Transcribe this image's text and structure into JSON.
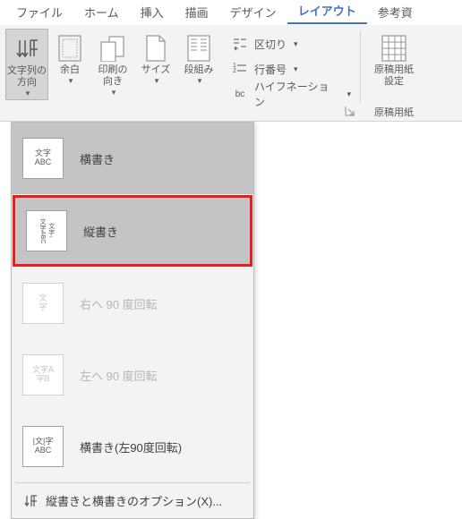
{
  "tabs": {
    "file": "ファイル",
    "home": "ホーム",
    "insert": "挿入",
    "draw": "描画",
    "design": "デザイン",
    "layout": "レイアウト",
    "references": "参考資"
  },
  "ribbon": {
    "textDirection": {
      "label": "文字列の\n方向"
    },
    "margins": {
      "label": "余白"
    },
    "orientation": {
      "label": "印刷の\n向き"
    },
    "size": {
      "label": "サイズ"
    },
    "columns": {
      "label": "段組み"
    },
    "breaks": {
      "label": "区切り"
    },
    "lineNumbers": {
      "label": "行番号"
    },
    "hyphenation": {
      "label": "ハイフネーション"
    },
    "manuscript": {
      "label": "原稿用紙\n設定"
    },
    "manuscriptGroup": {
      "label": "原稿用紙"
    }
  },
  "dropdown": {
    "items": [
      {
        "label": "横書き",
        "icoLines": [
          "文字",
          "ABC"
        ]
      },
      {
        "label": "縦書き",
        "icoLines": [
          "文字ABC",
          "文字↓"
        ]
      },
      {
        "label": "右へ 90 度回転",
        "icoLines": [
          "文",
          "字"
        ]
      },
      {
        "label": "左へ 90 度回転",
        "icoLines": [
          "文字A",
          "字B"
        ]
      },
      {
        "label": "横書き(左90度回転)",
        "icoLines": [
          "|文|字",
          "ABC"
        ]
      }
    ],
    "footer": "縦書きと横書きのオプション(X)..."
  }
}
